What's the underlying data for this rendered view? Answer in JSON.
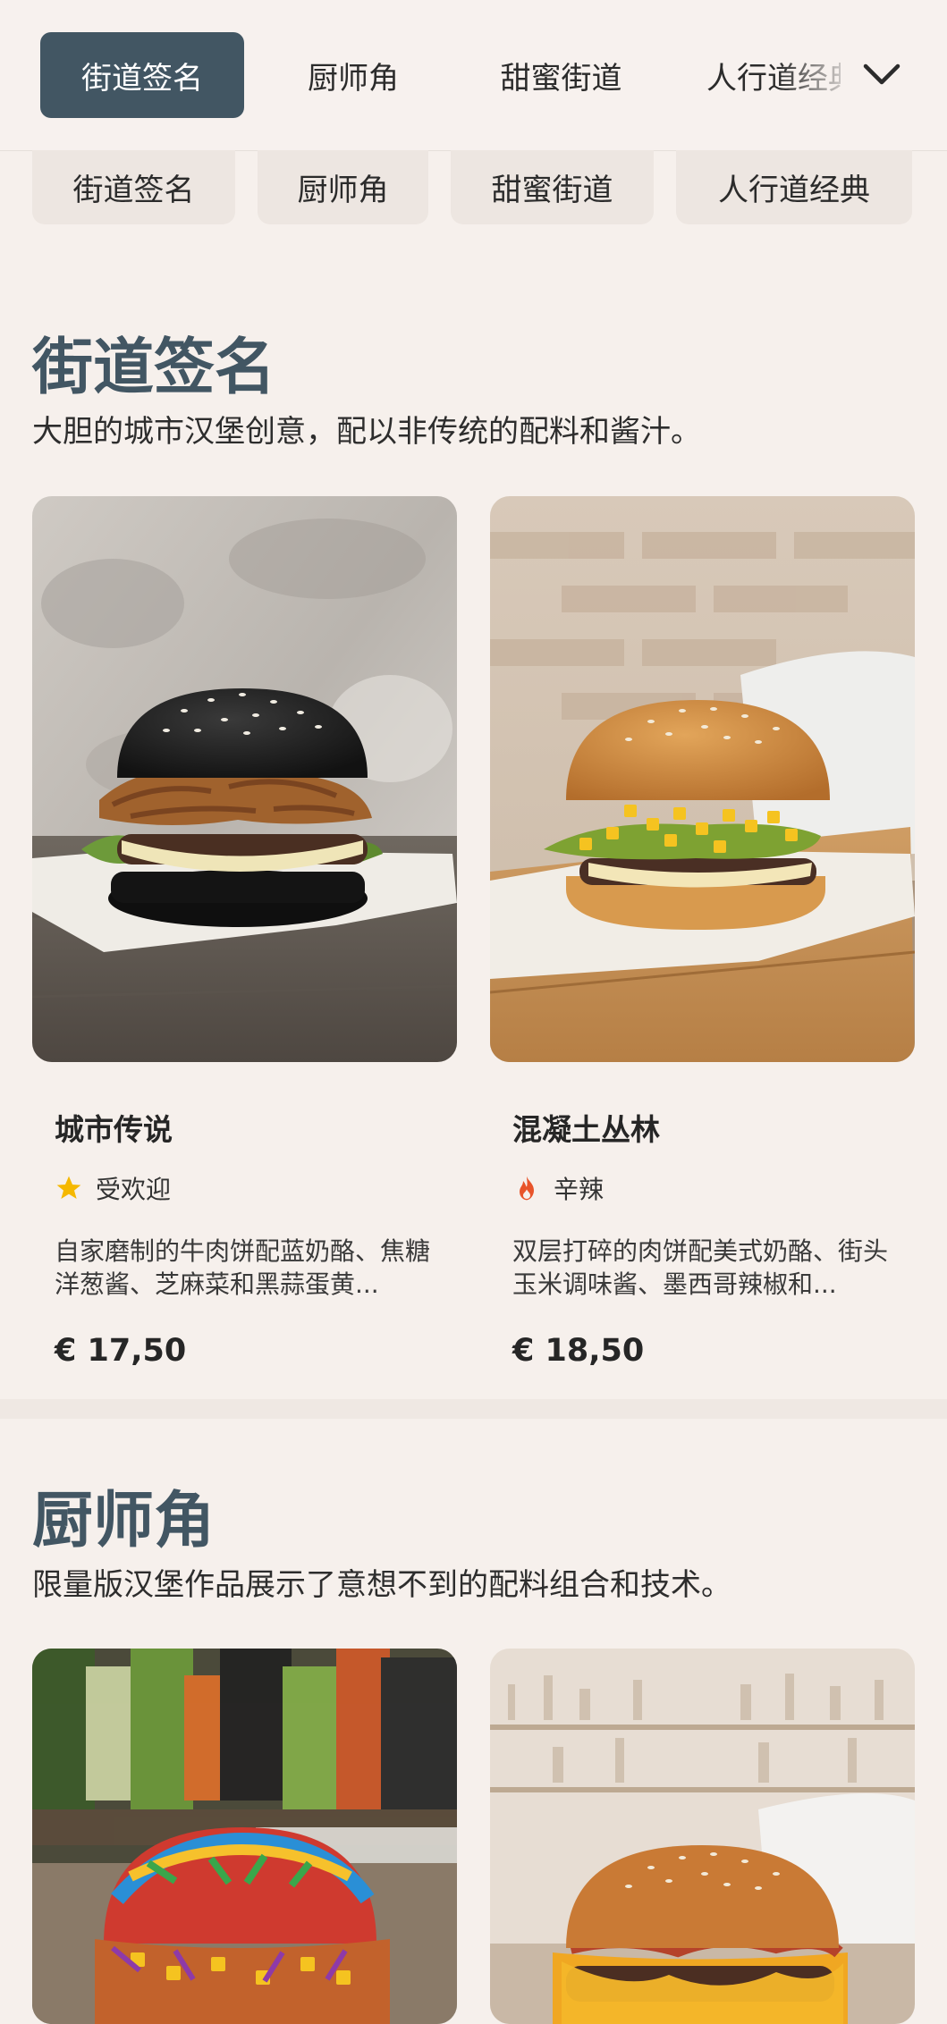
{
  "top_tabs": [
    "街道签名",
    "厨师角",
    "甜蜜街道",
    "人行道经典"
  ],
  "chips": [
    "街道签名",
    "厨师角",
    "甜蜜街道",
    "人行道经典"
  ],
  "sections": [
    {
      "title": "街道签名",
      "description": "大胆的城市汉堡创意，配以非传统的配料和酱汁。",
      "items": [
        {
          "name": "城市传说",
          "tag": "受欢迎",
          "tag_icon": "star-icon",
          "description": "自家磨制的牛肉饼配蓝奶酪、焦糖洋葱酱、芝麻菜和黑蒜蛋黄...",
          "price": "€ 17,50"
        },
        {
          "name": "混凝土丛林",
          "tag": "辛辣",
          "tag_icon": "flame-icon",
          "description": "双层打碎的肉饼配美式奶酪、街头玉米调味酱、墨西哥辣椒和...",
          "price": "€ 18,50"
        }
      ]
    },
    {
      "title": "厨师角",
      "description": "限量版汉堡作品展示了意想不到的配料组合和技术。"
    }
  ],
  "colors": {
    "accent": "#425663",
    "background": "#f6f0ec",
    "star": "#f5b800",
    "flame": "#e8542a"
  }
}
